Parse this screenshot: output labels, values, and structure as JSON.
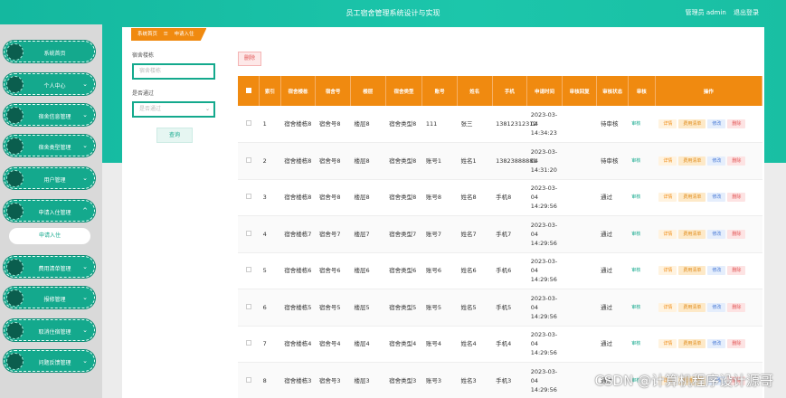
{
  "header": {
    "title": "员工宿舍管理系统设计与实现",
    "role": "管理员 admin",
    "logout": "退出登录"
  },
  "sidebar": {
    "items": [
      {
        "label": "系统首页",
        "arrow": ""
      },
      {
        "label": "个人中心",
        "arrow": "⌄"
      },
      {
        "label": "宿舍信息管理",
        "arrow": "⌄"
      },
      {
        "label": "宿舍类型管理",
        "arrow": "⌄"
      },
      {
        "label": "用户管理",
        "arrow": "⌄"
      },
      {
        "label": "申请入住管理",
        "arrow": "^"
      },
      {
        "label": "费用清单管理",
        "arrow": "⌄"
      },
      {
        "label": "报修管理",
        "arrow": "⌄"
      },
      {
        "label": "取消住宿管理",
        "arrow": "⌄"
      },
      {
        "label": "问题反馈管理",
        "arrow": "⌄"
      }
    ],
    "submenu": "申请入住"
  },
  "breadcrumb": {
    "home": "系统首页",
    "sep": "☰",
    "current": "申请入住"
  },
  "filters": {
    "building_label": "宿舍楼栋",
    "building_placeholder": "宿舍楼栋",
    "approved_label": "是否通过",
    "approved_placeholder": "是否通过",
    "search": "查询"
  },
  "toolbar": {
    "delete": "删除"
  },
  "table": {
    "headers": [
      "索引",
      "宿舍楼栋",
      "宿舍号",
      "楼层",
      "宿舍类型",
      "账号",
      "姓名",
      "手机",
      "申请时间",
      "审核回复",
      "审核状态",
      "审核",
      "操作"
    ],
    "actions": {
      "detail": "详情",
      "bill": "费用清单",
      "edit": "修改",
      "delete": "删除"
    },
    "review_link": "审核",
    "rows": [
      {
        "idx": "1",
        "building": "宿舍楼栋8",
        "room": "宿舍号8",
        "floor": "楼层8",
        "type": "宿舍类型8",
        "account": "111",
        "name": "张三",
        "phone": "13812312312",
        "time": "2023-03-04 14:34:23",
        "reply": "",
        "status": "待审核"
      },
      {
        "idx": "2",
        "building": "宿舍楼栋8",
        "room": "宿舍号8",
        "floor": "楼层8",
        "type": "宿舍类型8",
        "account": "账号1",
        "name": "姓名1",
        "phone": "13823888881",
        "time": "2023-03-04 14:31:20",
        "reply": "",
        "status": "待审核"
      },
      {
        "idx": "3",
        "building": "宿舍楼栋8",
        "room": "宿舍号8",
        "floor": "楼层8",
        "type": "宿舍类型8",
        "account": "账号8",
        "name": "姓名8",
        "phone": "手机8",
        "time": "2023-03-04 14:29:56",
        "reply": "",
        "status": "通过"
      },
      {
        "idx": "4",
        "building": "宿舍楼栋7",
        "room": "宿舍号7",
        "floor": "楼层7",
        "type": "宿舍类型7",
        "account": "账号7",
        "name": "姓名7",
        "phone": "手机7",
        "time": "2023-03-04 14:29:56",
        "reply": "",
        "status": "通过"
      },
      {
        "idx": "5",
        "building": "宿舍楼栋6",
        "room": "宿舍号6",
        "floor": "楼层6",
        "type": "宿舍类型6",
        "account": "账号6",
        "name": "姓名6",
        "phone": "手机6",
        "time": "2023-03-04 14:29:56",
        "reply": "",
        "status": "通过"
      },
      {
        "idx": "6",
        "building": "宿舍楼栋5",
        "room": "宿舍号5",
        "floor": "楼层5",
        "type": "宿舍类型5",
        "account": "账号5",
        "name": "姓名5",
        "phone": "手机5",
        "time": "2023-03-04 14:29:56",
        "reply": "",
        "status": "通过"
      },
      {
        "idx": "7",
        "building": "宿舍楼栋4",
        "room": "宿舍号4",
        "floor": "楼层4",
        "type": "宿舍类型4",
        "account": "账号4",
        "name": "姓名4",
        "phone": "手机4",
        "time": "2023-03-04 14:29:56",
        "reply": "",
        "status": "通过"
      },
      {
        "idx": "8",
        "building": "宿舍楼栋3",
        "room": "宿舍号3",
        "floor": "楼层3",
        "type": "宿舍类型3",
        "account": "账号3",
        "name": "姓名3",
        "phone": "手机3",
        "time": "2023-03-04 14:29:56",
        "reply": "",
        "status": "通过"
      }
    ]
  },
  "watermark": "CSDN @计算机程序设计源哥",
  "colors": {
    "brand": "#14a98d",
    "header_orange": "#f08a10",
    "danger": "#e25555",
    "primary": "#4a7bd6"
  }
}
